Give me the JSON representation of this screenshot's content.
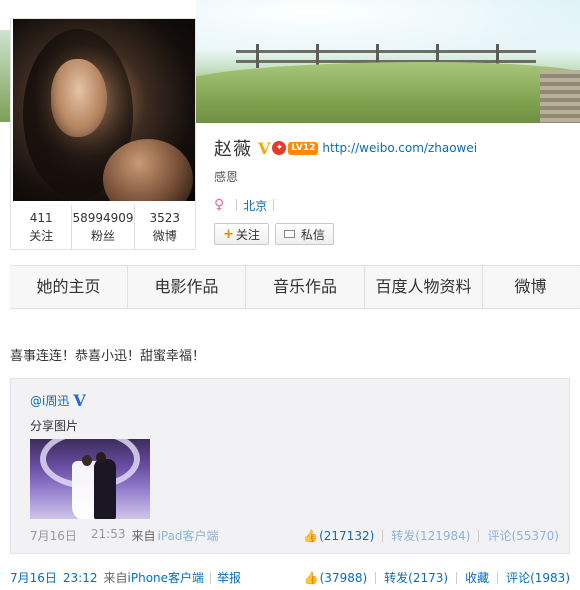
{
  "profile": {
    "name": "赵薇",
    "url": "http://weibo.com/zhaowei",
    "level_badge": "LV12",
    "description": "感恩",
    "location": "北京",
    "stats": [
      {
        "num": "411",
        "label": "关注"
      },
      {
        "num": "58994909",
        "label": "粉丝"
      },
      {
        "num": "3523",
        "label": "微博"
      }
    ],
    "follow_label": "关注",
    "message_label": "私信"
  },
  "tabs": [
    "她的主页",
    "电影作品",
    "音乐作品",
    "百度人物资料",
    "微博"
  ],
  "post": {
    "text": "喜事连连！恭喜小迅！甜蜜幸福！",
    "repost": {
      "user": "@i周迅",
      "text": "分享图片",
      "date": "7月16日",
      "time": "21:53",
      "from_prefix": "来自",
      "source": "iPad客户端",
      "likes": "(217132)",
      "reposts": "转发(121984)",
      "comments": "评论(55370)"
    },
    "meta": {
      "date": "7月16日",
      "time": "23:12",
      "from_prefix": "来自",
      "source": "iPhone客户端",
      "report": "举报",
      "likes": "(37988)",
      "reposts": "转发(2173)",
      "favorite": "收藏",
      "comments": "评论(1983)"
    }
  },
  "colors": {
    "link": "#0a6cb7",
    "verified_gold": "#f7a800",
    "verified_blue": "#2a66d9",
    "level_orange": "#ff8a00"
  }
}
